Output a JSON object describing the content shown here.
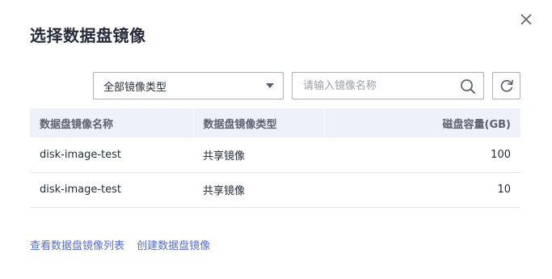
{
  "dialog": {
    "title": "选择数据盘镜像",
    "close_icon": "close-icon"
  },
  "toolbar": {
    "image_type_select": {
      "selected": "全部镜像类型",
      "icon": "caret-down-icon"
    },
    "search": {
      "placeholder": "请输入镜像名称",
      "value": "",
      "icon": "search-icon"
    },
    "refresh_icon": "refresh-icon"
  },
  "table": {
    "headers": [
      "数据盘镜像名称",
      "数据盘镜像类型",
      "磁盘容量(GB)"
    ],
    "rows": [
      {
        "name": "disk-image-test",
        "type": "共享镜像",
        "capacity": "100"
      },
      {
        "name": "disk-image-test",
        "type": "共享镜像",
        "capacity": "10"
      }
    ]
  },
  "footer_links": {
    "view_list": "查看数据盘镜像列表",
    "create": "创建数据盘镜像"
  },
  "colors": {
    "link": "#526ecc",
    "header_bg": "#eff1fa",
    "border": "#adb0b8"
  }
}
